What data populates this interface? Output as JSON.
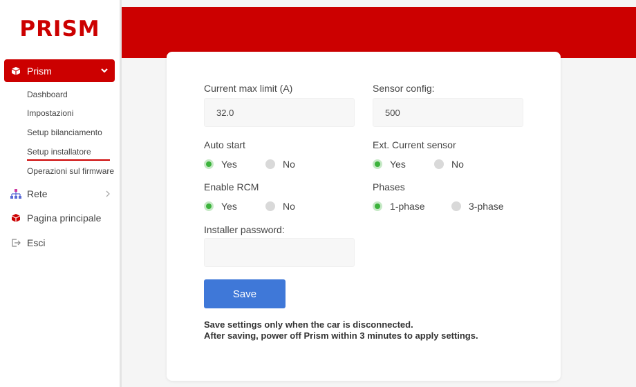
{
  "brand": {
    "logo": "PRISM"
  },
  "sidebar": {
    "active": {
      "label": "Prism"
    },
    "sub_items": [
      {
        "label": "Dashboard"
      },
      {
        "label": "Impostazioni"
      },
      {
        "label": "Setup bilanciamento"
      },
      {
        "label": "Setup installatore"
      },
      {
        "label": "Operazioni sul firmware"
      }
    ],
    "nav": [
      {
        "label": "Rete",
        "icon": "network-icon"
      },
      {
        "label": "Pagina principale",
        "icon": "cube-icon"
      },
      {
        "label": "Esci",
        "icon": "logout-icon"
      }
    ]
  },
  "form": {
    "current_max": {
      "label": "Current max limit (A)",
      "value": "32.0"
    },
    "sensor_config": {
      "label": "Sensor config:",
      "value": "500"
    },
    "auto_start": {
      "label": "Auto start",
      "options": [
        "Yes",
        "No"
      ],
      "selected": "Yes"
    },
    "ext_sensor": {
      "label": "Ext. Current sensor",
      "options": [
        "Yes",
        "No"
      ],
      "selected": "Yes"
    },
    "enable_rcm": {
      "label": "Enable RCM",
      "options": [
        "Yes",
        "No"
      ],
      "selected": "Yes"
    },
    "phases": {
      "label": "Phases",
      "options": [
        "1-phase",
        "3-phase"
      ],
      "selected": "1-phase"
    },
    "installer_password": {
      "label": "Installer password:",
      "value": ""
    },
    "save_label": "Save",
    "notes": [
      "Save settings only when the car is disconnected.",
      "After saving, power off Prism within 3 minutes to apply settings."
    ]
  },
  "colors": {
    "brand_red": "#cc0000",
    "button_blue": "#3f78d8",
    "radio_green": "#3cb33c"
  }
}
